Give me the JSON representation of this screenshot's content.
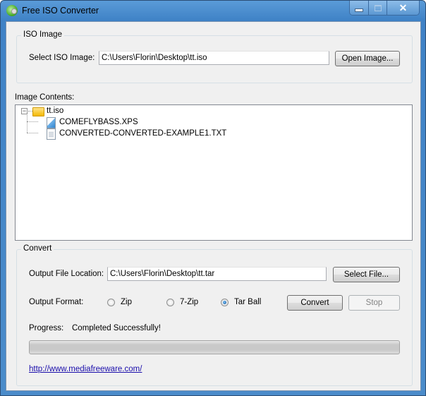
{
  "window": {
    "title": "Free ISO Converter",
    "caption_buttons": {
      "minimize": "minimize-icon",
      "maximize": "maximize-icon",
      "close": "✕"
    }
  },
  "iso_image": {
    "group_label": "ISO Image",
    "select_label": "Select ISO Image:",
    "path_value": "C:\\Users\\Florin\\Desktop\\tt.iso",
    "open_button": "Open Image..."
  },
  "image_contents": {
    "label": "Image Contents:",
    "tree": {
      "root": {
        "name": "tt.iso",
        "expanded": true,
        "icon": "folder-icon"
      },
      "children": [
        {
          "name": "COMEFLYBASS.XPS",
          "icon": "xps-file-icon"
        },
        {
          "name": "CONVERTED-CONVERTED-EXAMPLE1.TXT",
          "icon": "text-file-icon"
        }
      ]
    }
  },
  "convert": {
    "group_label": "Convert",
    "output_location_label": "Output File Location:",
    "output_location_value": "C:\\Users\\Florin\\Desktop\\tt.tar",
    "select_file_button": "Select File...",
    "output_format_label": "Output Format:",
    "formats": [
      {
        "label": "Zip",
        "checked": false
      },
      {
        "label": "7-Zip",
        "checked": false
      },
      {
        "label": "Tar Ball",
        "checked": true
      }
    ],
    "convert_button": "Convert",
    "stop_button": "Stop",
    "stop_enabled": false,
    "progress_label": "Progress:",
    "progress_status": "Completed Successfully!",
    "progress_fraction": 1.0,
    "link": "http://www.mediafreeware.com/"
  }
}
